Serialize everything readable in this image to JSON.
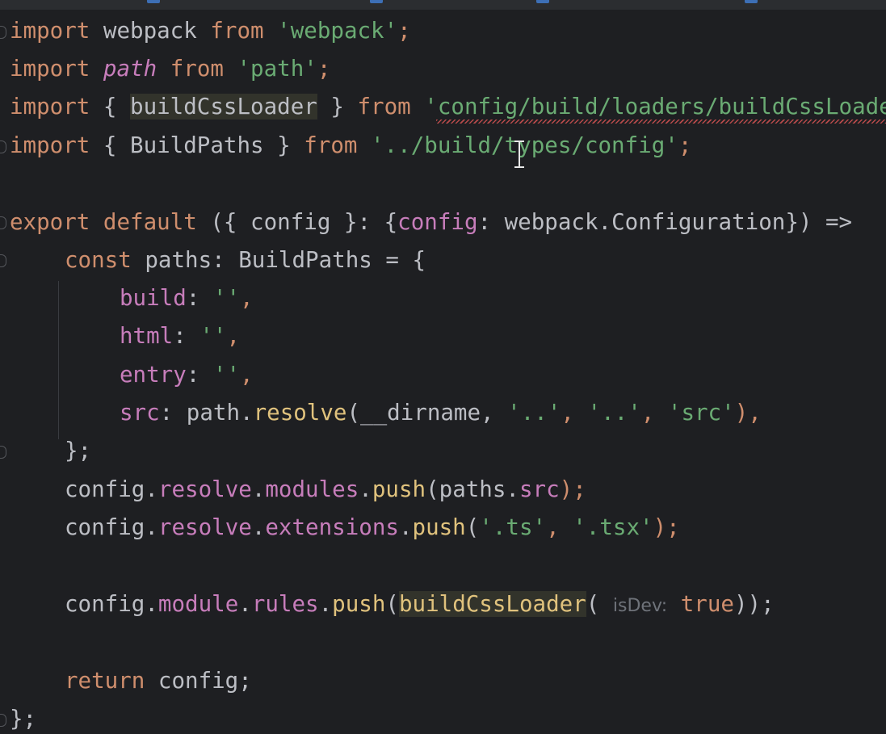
{
  "editor": {
    "lines": [
      [
        "import",
        " webpack ",
        "from",
        " ",
        "'webpack'",
        ";"
      ],
      [
        "import",
        " ",
        "path",
        " ",
        "from",
        " ",
        "'path'",
        ";"
      ],
      [
        "import",
        " { ",
        "buildCssLoader",
        " } ",
        "from",
        " ",
        "'config/build/loaders/buildCssLoader'"
      ],
      [
        "import",
        " { BuildPaths } ",
        "from",
        " ",
        "'../build/types/config'",
        ";"
      ],
      [
        "export",
        " ",
        "default",
        " ({ config }: {",
        "config",
        ": webpack.Configuration}) =>"
      ],
      [
        "const",
        " paths: BuildPaths = {"
      ],
      [
        "build",
        ": ",
        "''",
        ","
      ],
      [
        "html",
        ": ",
        "''",
        ","
      ],
      [
        "entry",
        ": ",
        "''",
        ","
      ],
      [
        "src",
        ": path.",
        "resolve",
        "(__dirname, ",
        "'..'",
        ", ",
        "'..'",
        ", ",
        "'src'",
        "),"
      ],
      [
        "};"
      ],
      [
        "config.",
        "resolve",
        ".",
        "modules",
        ".",
        "push",
        "(paths.",
        "src",
        ");"
      ],
      [
        "config.",
        "resolve",
        ".",
        "extensions",
        ".",
        "push",
        "(",
        "'.ts'",
        ", ",
        "'.tsx'",
        ");"
      ],
      [
        "config.",
        "module",
        ".",
        "rules",
        ".",
        "push",
        "(",
        "buildCssLoader",
        "( ",
        "isDev:",
        " ",
        "true",
        "));"
      ],
      [
        "return",
        " config;"
      ],
      [
        "};"
      ]
    ]
  }
}
